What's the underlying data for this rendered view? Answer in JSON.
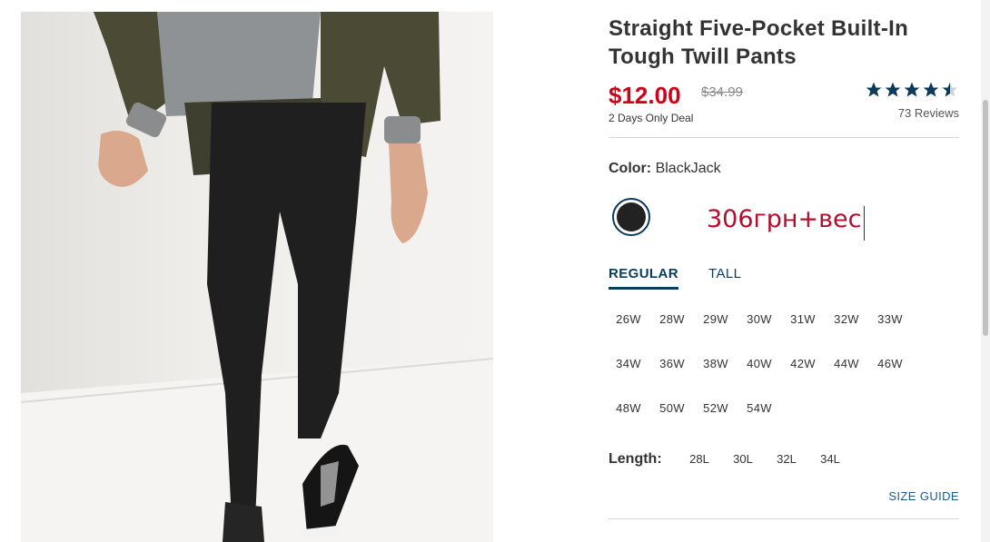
{
  "product": {
    "title": "Straight Five-Pocket Built-In Tough Twill Pants",
    "price_now": "$12.00",
    "price_was": "$34.99",
    "deal_text": "2 Days Only Deal",
    "rating": 4.5,
    "reviews": "73 Reviews"
  },
  "color": {
    "label": "Color:",
    "value": "BlackJack",
    "swatch_hex": "#222222"
  },
  "overlay": {
    "text": "306грн+вес",
    "color": "#b00f2d"
  },
  "fit_tabs": [
    {
      "label": "REGULAR",
      "active": true
    },
    {
      "label": "TALL",
      "active": false
    }
  ],
  "waist_sizes": [
    "26W",
    "28W",
    "29W",
    "30W",
    "31W",
    "32W",
    "33W",
    "34W",
    "36W",
    "38W",
    "40W",
    "42W",
    "44W",
    "46W",
    "48W",
    "50W",
    "52W",
    "54W"
  ],
  "length": {
    "label": "Length:",
    "options": [
      "28L",
      "30L",
      "32L",
      "34L"
    ]
  },
  "size_guide": "SIZE GUIDE",
  "colors": {
    "brand_navy": "#0d3b5c",
    "sale_red": "#d0021b"
  }
}
